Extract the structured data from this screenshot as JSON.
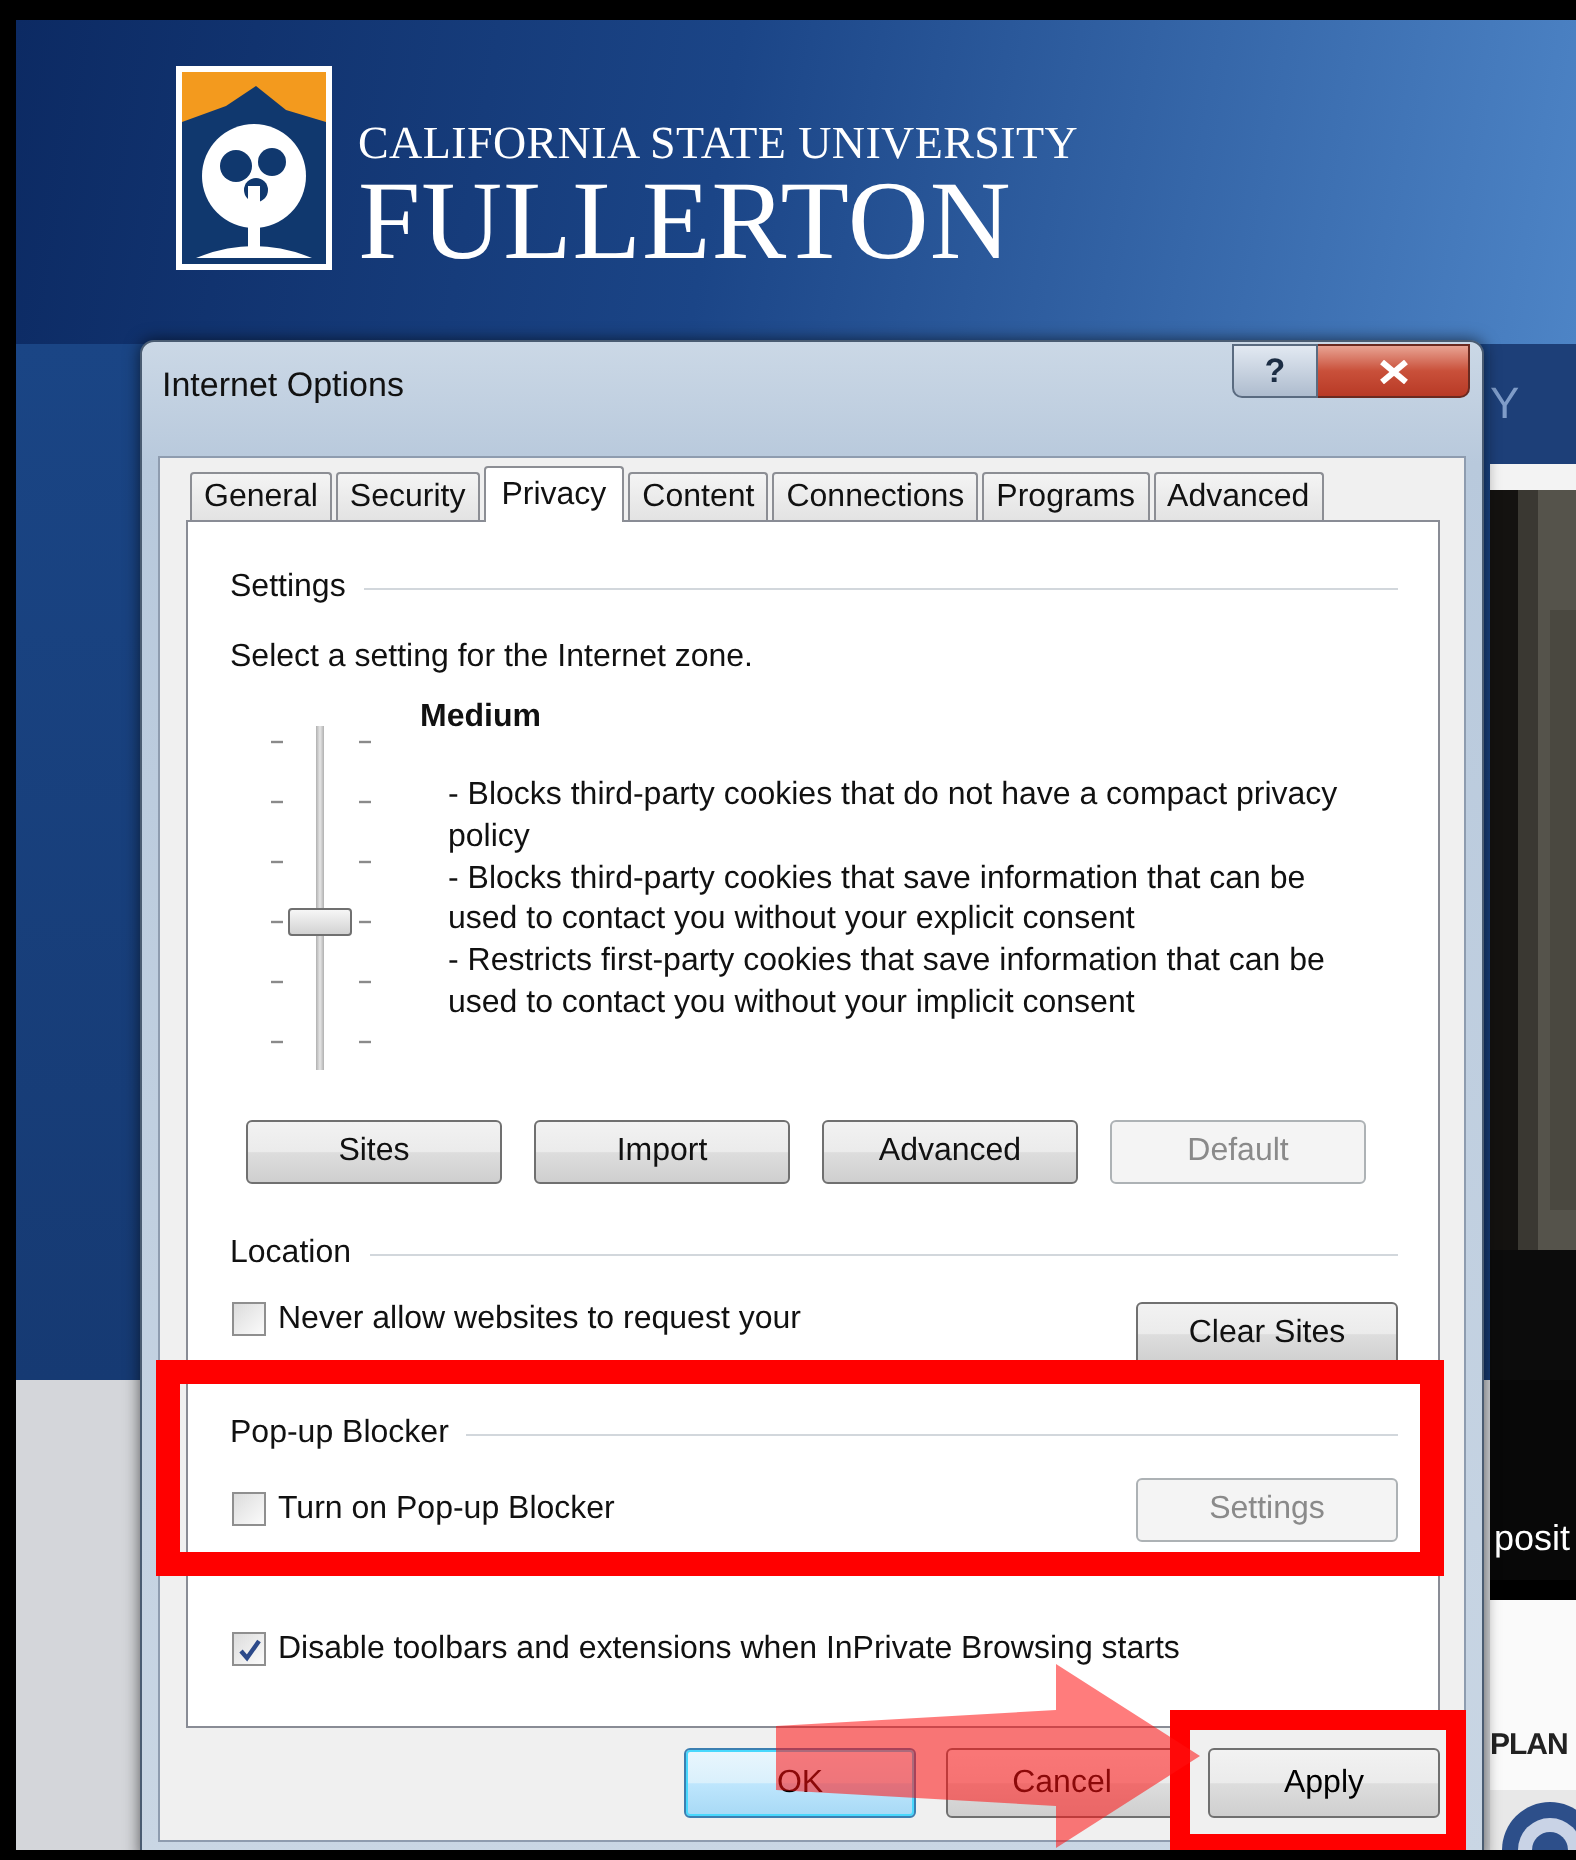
{
  "web_page": {
    "logo_title": "CALIFORNIA STATE UNIVERSITY",
    "logo_name": "FULLERTON",
    "nav_fragment": "Y",
    "side_text": "posit",
    "side_heading": "PLAN"
  },
  "dialog": {
    "title": "Internet Options",
    "help_label": "?",
    "tabs": [
      {
        "label": "General",
        "selected": false
      },
      {
        "label": "Security",
        "selected": false
      },
      {
        "label": "Privacy",
        "selected": true
      },
      {
        "label": "Content",
        "selected": false
      },
      {
        "label": "Connections",
        "selected": false
      },
      {
        "label": "Programs",
        "selected": false
      },
      {
        "label": "Advanced",
        "selected": false
      }
    ],
    "settings": {
      "heading": "Settings",
      "prompt": "Select a setting for the Internet zone.",
      "level_name": "Medium",
      "slider": {
        "level": 0.4
      },
      "description": [
        "- Blocks third-party cookies that do not have a compact privacy policy",
        "- Blocks third-party cookies that save information that can be used to contact you without your explicit consent",
        "- Restricts first-party cookies that save information that can be used to contact you without your implicit consent"
      ],
      "buttons": [
        {
          "label": "Sites",
          "disabled": false
        },
        {
          "label": "Import",
          "disabled": false
        },
        {
          "label": "Advanced",
          "disabled": false
        },
        {
          "label": "Default",
          "disabled": true
        }
      ]
    },
    "location": {
      "heading": "Location",
      "checkbox": {
        "label": "Never allow websites to request your",
        "checked": false
      },
      "button": {
        "label": "Clear Sites",
        "disabled": false
      }
    },
    "popup_blocker": {
      "heading": "Pop-up Blocker",
      "checkbox": {
        "label": "Turn on Pop-up Blocker",
        "checked": false
      },
      "button": {
        "label": "Settings",
        "disabled": true
      }
    },
    "inprivate": {
      "label": "Disable toolbars and extensions when InPrivate Browsing starts",
      "checked": true
    },
    "buttons": [
      {
        "label": "OK",
        "kind": "default"
      },
      {
        "label": "Cancel",
        "kind": "normal"
      },
      {
        "label": "Apply",
        "kind": "normal"
      }
    ]
  }
}
